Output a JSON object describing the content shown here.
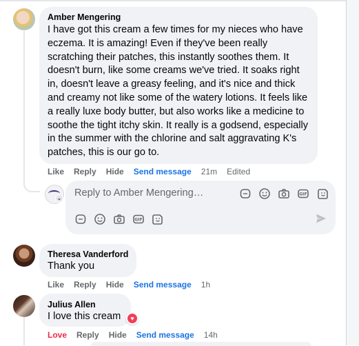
{
  "comments": [
    {
      "author": "Amber Mengering",
      "text": "I have got this cream a few times for my nieces who have eczema. It is amazing! Even if they've been really scratching their patches, this instantly soothes them. It doesn't burn, like some creams we've tried. It soaks right in, doesn't leave a greasy feeling, and it's nice and thick and creamy not like some of the watery lotions. It feels like a really luxe body butter, but also works like a medicine to soothe the tight itchy skin. It really is a godsend, especially in the summer with the chlorine and salt aggravating K's patches, this is our go to.",
      "actions": {
        "like": "Like",
        "reply": "Reply",
        "hide": "Hide",
        "send": "Send message",
        "time": "21m",
        "edited": "Edited"
      }
    },
    {
      "author": "Theresa Vanderford",
      "text": "Thank you",
      "actions": {
        "like": "Like",
        "reply": "Reply",
        "hide": "Hide",
        "send": "Send message",
        "time": "1h"
      }
    },
    {
      "author": "Julius Allen",
      "text": "I love this cream",
      "reaction": "heart-icon",
      "actions": {
        "like": "Love",
        "reply": "Reply",
        "hide": "Hide",
        "send": "Send message",
        "time": "14h"
      }
    }
  ],
  "reply_box": {
    "placeholder": "Reply to Amber Mengering…",
    "icons": [
      "sticker-icon",
      "emoji-icon",
      "camera-icon",
      "gif-icon",
      "avatar-sticker-icon",
      "send-icon"
    ]
  },
  "colors": {
    "link": "#1b74e4",
    "love": "#f02849",
    "bubble": "#f0f2f5",
    "muted": "#65676b"
  }
}
